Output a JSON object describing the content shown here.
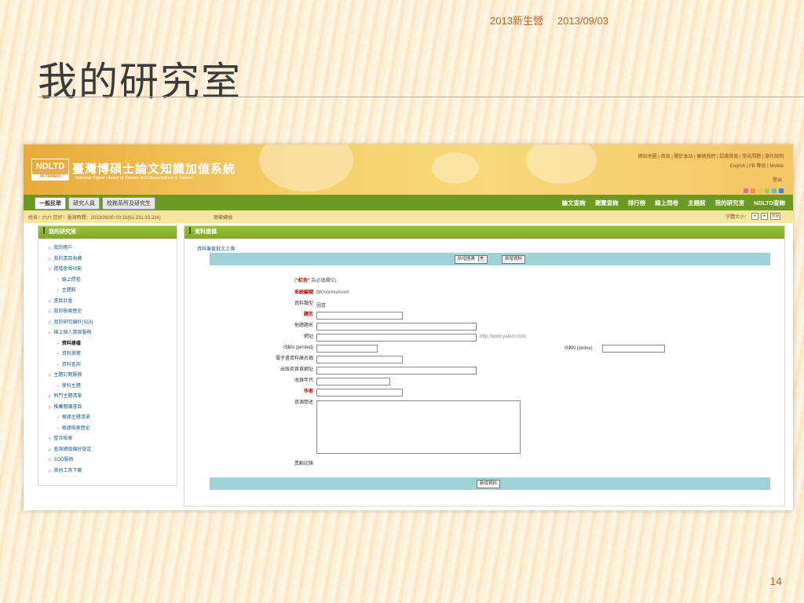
{
  "slide": {
    "header_left": "2013新生營",
    "header_date": "2013/09/03",
    "title": "我的研究室",
    "page_number": "14"
  },
  "site": {
    "logo_text": "NDLTD",
    "logo_sub": "IN TAIWAN",
    "title": "臺灣博碩士論文知識加值系統",
    "subtitle": "National Digital Library of Theses and Dissertations in Taiwan",
    "top_links_row1": "網站地圖 | 首頁 | 關於本站 | 聯絡我們 | 認識首頁 | 常見問題 | 操作說明",
    "top_links_row2": "English | FB 專頁 | Mobile",
    "logout": "登出",
    "theme_colors": [
      "#d86fa3",
      "#e99447",
      "#e9c447",
      "#9ccf4a",
      "#6fb7d8",
      "#4b7fcc"
    ]
  },
  "nav": {
    "tabs": [
      "一般民眾",
      "研究人員",
      "校務系所及研究生"
    ],
    "active_tab": 0,
    "menu": [
      "論文查詢",
      "瀏覽查詢",
      "排行榜",
      "線上問卷",
      "主題館",
      "我的研究室",
      "NDLTD查詢"
    ]
  },
  "infobar": {
    "user": "姓名：六六 您好！臺灣時間：2013/08/30 03:10(61.231.93.224)",
    "option": "簡繁轉換",
    "font_size_label": "字體大小：",
    "font_size_options": [
      "●",
      "●",
      "預設"
    ]
  },
  "sidebar": {
    "title": "我的研究室",
    "items": [
      {
        "label": "我的帳戶",
        "level": 1
      },
      {
        "label": "我的書目收藏",
        "level": 1
      },
      {
        "label": "進階會員功能",
        "level": 1
      },
      {
        "label": "線上問卷",
        "level": 2
      },
      {
        "label": "主題館",
        "level": 2
      },
      {
        "label": "書目計量",
        "level": 1
      },
      {
        "label": "我的檢索歷史",
        "level": 1
      },
      {
        "label": "我的研究偏好(SDI)",
        "level": 1
      },
      {
        "label": "線上個人書目服務",
        "level": 1
      },
      {
        "label": "資料建檔",
        "level": 2,
        "current": true
      },
      {
        "label": "資料瀏覽",
        "level": 2
      },
      {
        "label": "資料查詢",
        "level": 2
      },
      {
        "label": "主題訂閱服務",
        "level": 1
      },
      {
        "label": "學科主題",
        "level": 2
      },
      {
        "label": "熱門主題清單",
        "level": 1
      },
      {
        "label": "推薦閱讀書目",
        "level": 1
      },
      {
        "label": "根據主題清單",
        "level": 2
      },
      {
        "label": "根據檢索歷史",
        "level": 2
      },
      {
        "label": "整合檢索",
        "level": 1
      },
      {
        "label": "查詢網頁偏好設定",
        "level": 1
      },
      {
        "label": "SOD服務",
        "level": 1
      },
      {
        "label": "其他工具下載",
        "level": 1
      }
    ]
  },
  "content": {
    "title": "資料建檔",
    "bulk_upload_link": "資料筆量批次上傳",
    "type_select": "新增圖書",
    "add_button_top": "新增資料",
    "note_prefix": "(",
    "note_red": "\"紅色\"",
    "note_suffix": "為必填欄位)",
    "fields": {
      "system_id_label": "系統編號",
      "system_id_value": "BK##########",
      "data_type_label": "資料類型",
      "data_type_value": "圖書",
      "title_label": "題名",
      "alt_title_label": "他題題名",
      "url_label": "網址",
      "url_hint": "http://www.yahoo.com",
      "isbn_print_label": "ISBN (printed)",
      "isbn_online_label": "ISBN (online)",
      "ebook_db_label": "電子書資料庫名稱",
      "publisher_url_label": "出版商首頁網址",
      "year_label": "收錄年代",
      "author_label": "作者",
      "abstract_label": "資源簡述",
      "history_label": "異動記錄"
    },
    "add_button_bottom": "新增資料"
  }
}
